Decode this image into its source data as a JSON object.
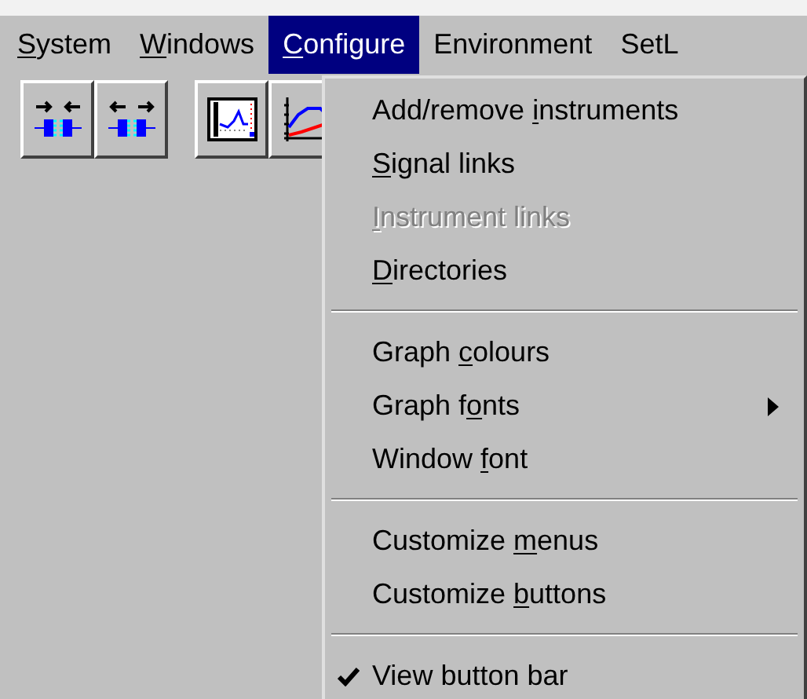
{
  "menu_bar": [
    {
      "label": {
        "key": "S",
        "after": "ystem"
      },
      "selected": false
    },
    {
      "label": {
        "key": "W",
        "after": "indows"
      },
      "selected": false
    },
    {
      "label": {
        "key": "C",
        "after": "onfigure"
      },
      "selected": true
    },
    {
      "label": {
        "before": "Environment"
      },
      "selected": false
    },
    {
      "label": {
        "before": "SetL"
      },
      "selected": false
    }
  ],
  "toolbar": [
    {
      "kind": "connect"
    },
    {
      "kind": "disconnect"
    },
    {
      "kind": "panel"
    },
    {
      "kind": "graph"
    }
  ],
  "dropdown": [
    {
      "kind": "item",
      "label": {
        "before": "Add/remove ",
        "key": "i",
        "after": "nstruments"
      },
      "disabled": false,
      "checked": false,
      "submenu": false
    },
    {
      "kind": "item",
      "label": {
        "key": "S",
        "after": "ignal links"
      },
      "disabled": false,
      "checked": false,
      "submenu": false
    },
    {
      "kind": "item",
      "label": {
        "key": "I",
        "after": "nstrument links"
      },
      "disabled": true,
      "checked": false,
      "submenu": false
    },
    {
      "kind": "item",
      "label": {
        "key": "D",
        "after": "irectories"
      },
      "disabled": false,
      "checked": false,
      "submenu": false
    },
    {
      "kind": "separator"
    },
    {
      "kind": "item",
      "label": {
        "before": "Graph ",
        "key": "c",
        "after": "olours"
      },
      "disabled": false,
      "checked": false,
      "submenu": false
    },
    {
      "kind": "item",
      "label": {
        "before": "Graph f",
        "key": "o",
        "after": "nts"
      },
      "disabled": false,
      "checked": false,
      "submenu": true
    },
    {
      "kind": "item",
      "label": {
        "before": "Window ",
        "key": "f",
        "after": "ont"
      },
      "disabled": false,
      "checked": false,
      "submenu": false
    },
    {
      "kind": "separator"
    },
    {
      "kind": "item",
      "label": {
        "before": "Customize ",
        "key": "m",
        "after": "enus"
      },
      "disabled": false,
      "checked": false,
      "submenu": false
    },
    {
      "kind": "item",
      "label": {
        "before": "Customize ",
        "key": "b",
        "after": "uttons"
      },
      "disabled": false,
      "checked": false,
      "submenu": false
    },
    {
      "kind": "separator"
    },
    {
      "kind": "item",
      "label": {
        "before": "View button bar"
      },
      "disabled": false,
      "checked": true,
      "submenu": false
    }
  ]
}
